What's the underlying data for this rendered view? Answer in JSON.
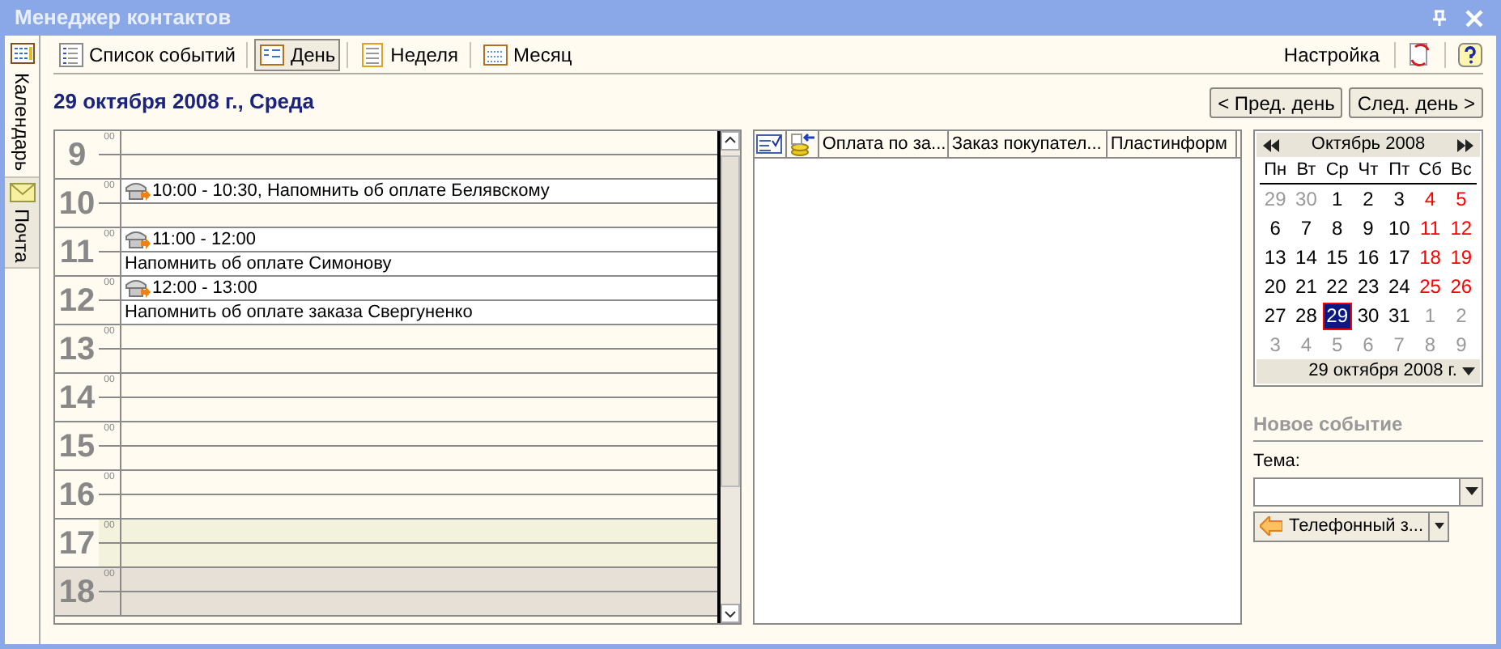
{
  "window": {
    "title": "Менеджер контактов"
  },
  "side_tabs": [
    {
      "label": "Календарь",
      "selected": true,
      "kind": "calendar"
    },
    {
      "label": "Почта",
      "selected": false,
      "kind": "mail"
    }
  ],
  "toolbar": {
    "views": [
      {
        "label": "Список событий",
        "selected": false,
        "kind": "list"
      },
      {
        "label": "День",
        "selected": true,
        "kind": "day"
      },
      {
        "label": "Неделя",
        "selected": false,
        "kind": "week"
      },
      {
        "label": "Месяц",
        "selected": false,
        "kind": "month"
      }
    ],
    "settings": "Настройка"
  },
  "date_heading": "29 октября 2008 г., Среда",
  "nav": {
    "prev": "< Пред. день",
    "next": "След. день >"
  },
  "day_view": {
    "hours": [
      {
        "hour": "9",
        "minutes": "00",
        "kind": "work"
      },
      {
        "hour": "10",
        "minutes": "00",
        "kind": "work",
        "events": [
          {
            "lines": [
              "10:00 - 10:30, Напомнить об оплате Белявскому"
            ]
          }
        ]
      },
      {
        "hour": "11",
        "minutes": "00",
        "kind": "work",
        "events": [
          {
            "lines": [
              "11:00 - 12:00",
              "Напомнить об оплате Симонову"
            ]
          }
        ]
      },
      {
        "hour": "12",
        "minutes": "00",
        "kind": "work",
        "events": [
          {
            "lines": [
              "12:00 - 13:00",
              "Напомнить об оплате заказа Свергуненко"
            ]
          }
        ]
      },
      {
        "hour": "13",
        "minutes": "00",
        "kind": "work"
      },
      {
        "hour": "14",
        "minutes": "00",
        "kind": "work"
      },
      {
        "hour": "15",
        "minutes": "00",
        "kind": "work"
      },
      {
        "hour": "16",
        "minutes": "00",
        "kind": "work"
      },
      {
        "hour": "17",
        "minutes": "00",
        "kind": "evening"
      },
      {
        "hour": "18",
        "minutes": "00",
        "kind": "off"
      }
    ]
  },
  "table": {
    "columns": [
      "Оплата по за...",
      "Заказ покупател...",
      "Пластинформ"
    ]
  },
  "calendar": {
    "month": "Октябрь 2008",
    "weekdays": [
      "Пн",
      "Вт",
      "Ср",
      "Чт",
      "Пт",
      "Сб",
      "Вс"
    ],
    "days": [
      {
        "label": "29",
        "kind": "other",
        "selected": false
      },
      {
        "label": "30",
        "kind": "other",
        "selected": false
      },
      {
        "label": "1",
        "kind": "normal",
        "selected": false
      },
      {
        "label": "2",
        "kind": "normal",
        "selected": false
      },
      {
        "label": "3",
        "kind": "normal",
        "selected": false
      },
      {
        "label": "4",
        "kind": "weekend",
        "selected": false
      },
      {
        "label": "5",
        "kind": "weekend",
        "selected": false
      },
      {
        "label": "6",
        "kind": "normal",
        "selected": false
      },
      {
        "label": "7",
        "kind": "normal",
        "selected": false
      },
      {
        "label": "8",
        "kind": "normal",
        "selected": false
      },
      {
        "label": "9",
        "kind": "normal",
        "selected": false
      },
      {
        "label": "10",
        "kind": "normal",
        "selected": false
      },
      {
        "label": "11",
        "kind": "weekend",
        "selected": false
      },
      {
        "label": "12",
        "kind": "weekend",
        "selected": false
      },
      {
        "label": "13",
        "kind": "normal",
        "selected": false
      },
      {
        "label": "14",
        "kind": "normal",
        "selected": false
      },
      {
        "label": "15",
        "kind": "normal",
        "selected": false
      },
      {
        "label": "16",
        "kind": "normal",
        "selected": false
      },
      {
        "label": "17",
        "kind": "normal",
        "selected": false
      },
      {
        "label": "18",
        "kind": "weekend",
        "selected": false
      },
      {
        "label": "19",
        "kind": "weekend",
        "selected": false
      },
      {
        "label": "20",
        "kind": "normal",
        "selected": false
      },
      {
        "label": "21",
        "kind": "normal",
        "selected": false
      },
      {
        "label": "22",
        "kind": "normal",
        "selected": false
      },
      {
        "label": "23",
        "kind": "normal",
        "selected": false
      },
      {
        "label": "24",
        "kind": "normal",
        "selected": false
      },
      {
        "label": "25",
        "kind": "weekend",
        "selected": false
      },
      {
        "label": "26",
        "kind": "weekend",
        "selected": false
      },
      {
        "label": "27",
        "kind": "normal",
        "selected": false
      },
      {
        "label": "28",
        "kind": "normal",
        "selected": false
      },
      {
        "label": "29",
        "kind": "normal",
        "selected": true
      },
      {
        "label": "30",
        "kind": "normal",
        "selected": false
      },
      {
        "label": "31",
        "kind": "normal",
        "selected": false
      },
      {
        "label": "1",
        "kind": "other",
        "selected": false
      },
      {
        "label": "2",
        "kind": "other",
        "selected": false
      },
      {
        "label": "3",
        "kind": "other",
        "selected": false
      },
      {
        "label": "4",
        "kind": "other",
        "selected": false
      },
      {
        "label": "5",
        "kind": "other",
        "selected": false
      },
      {
        "label": "6",
        "kind": "other",
        "selected": false
      },
      {
        "label": "7",
        "kind": "other",
        "selected": false
      },
      {
        "label": "8",
        "kind": "other",
        "selected": false
      },
      {
        "label": "9",
        "kind": "other",
        "selected": false
      }
    ],
    "footer": "29 октября 2008 г."
  },
  "new_event": {
    "heading": "Новое событие",
    "subject_label": "Тема:",
    "type_button": "Телефонный з..."
  }
}
